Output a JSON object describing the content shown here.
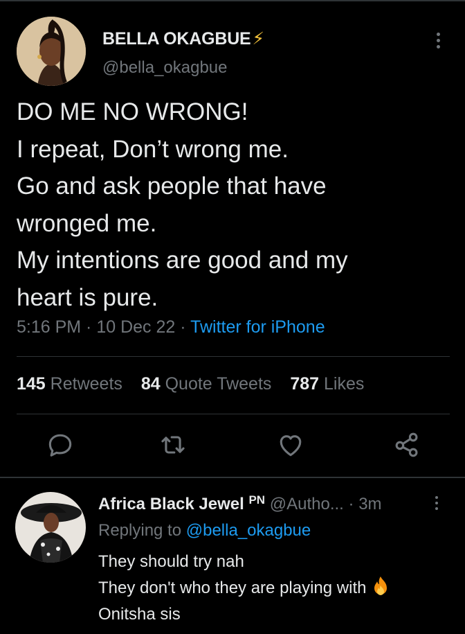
{
  "tweet": {
    "author_name": "BELLA OKAGBUE",
    "author_badge": "⚡",
    "author_handle": "@bella_okagbue",
    "text_lines": [
      "DO ME NO WRONG!",
      "I repeat, Don’t wrong me.",
      "Go and ask people that have",
      "wronged me.",
      "My intentions are good and my",
      "heart is pure."
    ],
    "time": "5:16 PM",
    "date": "10 Dec 22",
    "source": "Twitter for iPhone",
    "separator": " · "
  },
  "stats": {
    "retweets_count": "145",
    "retweets_label": "Retweets",
    "quotes_count": "84",
    "quotes_label": "Quote Tweets",
    "likes_count": "787",
    "likes_label": "Likes"
  },
  "actions": {
    "icons": [
      "reply-icon",
      "retweet-icon",
      "like-icon",
      "share-icon"
    ]
  },
  "reply": {
    "name": "Africa Black Jewel",
    "badge": "PN",
    "handle": "@Autho...",
    "time": "· 3m",
    "replying_prefix": "Replying to",
    "replying_handle": "@bella_okagbue",
    "lines": [
      "They should try nah",
      "They don't who they are playing with",
      "Onitsha sis"
    ],
    "emoji": "fire-icon"
  },
  "colors": {
    "background": "#000000",
    "text": "#e7e9ea",
    "muted": "#71767b",
    "accent": "#1d9bf0",
    "divider": "#2f3336"
  }
}
